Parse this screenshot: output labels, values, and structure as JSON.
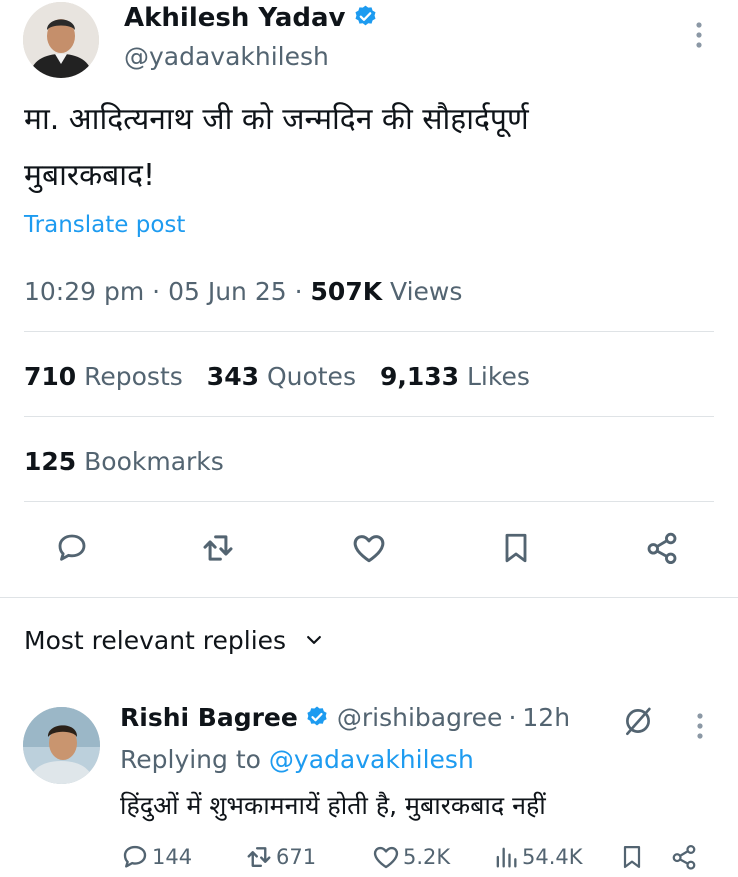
{
  "post": {
    "author_name": "Akhilesh Yadav",
    "author_handle": "@yadavakhilesh",
    "text_line1": "मा. आदित्यनाथ जी को जन्मदिन की सौहार्दपूर्ण",
    "text_line2": "मुबारकबाद!",
    "translate_label": "Translate post",
    "time": "10:29 pm",
    "date": "05 Jun 25",
    "views_count": "507K",
    "views_label": "Views",
    "reposts_count": "710",
    "reposts_label": "Reposts",
    "quotes_count": "343",
    "quotes_label": "Quotes",
    "likes_count": "9,133",
    "likes_label": "Likes",
    "bookmarks_count": "125",
    "bookmarks_label": "Bookmarks",
    "separator": "·"
  },
  "actions": {
    "icons": [
      "reply-icon",
      "repost-icon",
      "like-icon",
      "bookmark-icon",
      "share-icon"
    ]
  },
  "replies_section": {
    "title": "Most relevant replies"
  },
  "reply": {
    "author_name": "Rishi Bagree",
    "author_handle": "@rishibagree",
    "age": "12h",
    "replying_to_label": "Replying to",
    "replying_to_handle": "@yadavakhilesh",
    "text": "हिंदुओं में शुभकामनायें होती है, मुबारकबाद नहीं",
    "reply_count": "144",
    "repost_count": "671",
    "like_count": "5.2K",
    "view_count": "54.4K"
  },
  "colors": {
    "accent": "#1d9bf0",
    "text": "#0f1419",
    "muted": "#536471",
    "divider": "#dfe3e6"
  }
}
